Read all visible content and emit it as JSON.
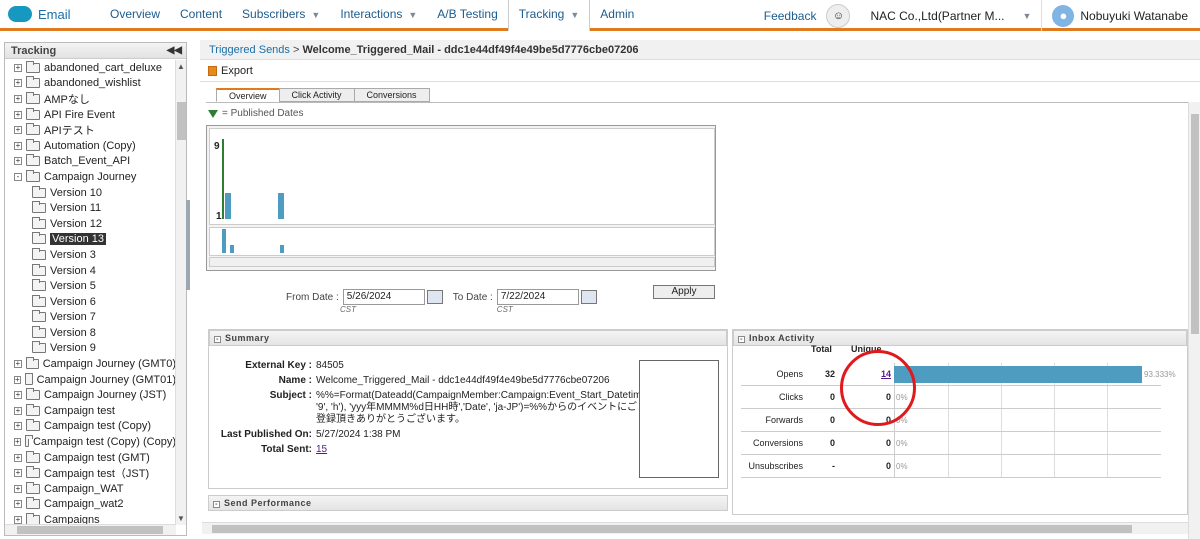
{
  "app": {
    "logo_text": "Email"
  },
  "nav": {
    "items": [
      {
        "label": "Overview",
        "caret": false
      },
      {
        "label": "Content",
        "caret": false
      },
      {
        "label": "Subscribers",
        "caret": true
      },
      {
        "label": "Interactions",
        "caret": true
      },
      {
        "label": "A/B Testing",
        "caret": false
      },
      {
        "label": "Tracking",
        "caret": true,
        "active": true
      },
      {
        "label": "Admin",
        "caret": false
      }
    ],
    "feedback": "Feedback",
    "org": "NAC Co.,Ltd(Partner M...",
    "user": "Nobuyuki Watanabe"
  },
  "sidebar": {
    "title": "Tracking",
    "items": [
      {
        "label": "abandoned_cart_deluxe",
        "indent": 0,
        "exp": "+"
      },
      {
        "label": "abandoned_wishlist",
        "indent": 0,
        "exp": "+"
      },
      {
        "label": "AMPなし",
        "indent": 0,
        "exp": "+"
      },
      {
        "label": "API Fire Event",
        "indent": 0,
        "exp": "+"
      },
      {
        "label": "APIテスト",
        "indent": 0,
        "exp": "+"
      },
      {
        "label": "Automation (Copy)",
        "indent": 0,
        "exp": "+"
      },
      {
        "label": "Batch_Event_API",
        "indent": 0,
        "exp": "+"
      },
      {
        "label": "Campaign Journey",
        "indent": 0,
        "exp": "-"
      },
      {
        "label": "Version 10",
        "indent": 1,
        "exp": ""
      },
      {
        "label": "Version 11",
        "indent": 1,
        "exp": ""
      },
      {
        "label": "Version 12",
        "indent": 1,
        "exp": ""
      },
      {
        "label": "Version 13",
        "indent": 1,
        "exp": "",
        "selected": true
      },
      {
        "label": "Version 3",
        "indent": 1,
        "exp": ""
      },
      {
        "label": "Version 4",
        "indent": 1,
        "exp": ""
      },
      {
        "label": "Version 5",
        "indent": 1,
        "exp": ""
      },
      {
        "label": "Version 6",
        "indent": 1,
        "exp": ""
      },
      {
        "label": "Version 7",
        "indent": 1,
        "exp": ""
      },
      {
        "label": "Version 8",
        "indent": 1,
        "exp": ""
      },
      {
        "label": "Version 9",
        "indent": 1,
        "exp": ""
      },
      {
        "label": "Campaign Journey (GMT0)",
        "indent": 0,
        "exp": "+"
      },
      {
        "label": "Campaign Journey (GMT01)",
        "indent": 0,
        "exp": "+"
      },
      {
        "label": "Campaign Journey (JST)",
        "indent": 0,
        "exp": "+"
      },
      {
        "label": "Campaign test",
        "indent": 0,
        "exp": "+"
      },
      {
        "label": "Campaign test (Copy)",
        "indent": 0,
        "exp": "+"
      },
      {
        "label": "Campaign test (Copy) (Copy)",
        "indent": 0,
        "exp": "+"
      },
      {
        "label": "Campaign test (GMT)",
        "indent": 0,
        "exp": "+"
      },
      {
        "label": "Campaign test（JST)",
        "indent": 0,
        "exp": "+"
      },
      {
        "label": "Campaign_WAT",
        "indent": 0,
        "exp": "+"
      },
      {
        "label": "Campaign_wat2",
        "indent": 0,
        "exp": "+"
      },
      {
        "label": "Campaigns",
        "indent": 0,
        "exp": "+"
      }
    ]
  },
  "breadcrumb": {
    "link": "Triggered Sends",
    "sep": " > ",
    "current": "Welcome_Triggered_Mail - ddc1e44df49f4e49be5d7776cbe07206"
  },
  "toolbar": {
    "export": "Export"
  },
  "tabs": [
    "Overview",
    "Click Activity",
    "Conversions"
  ],
  "legend": {
    "published": "= Published Dates"
  },
  "chart": {
    "y_top": "9",
    "y_bottom": "1"
  },
  "chart_data": {
    "type": "bar",
    "title": "",
    "ylim": [
      1,
      9
    ],
    "series": [
      {
        "values": [
          1,
          9,
          2,
          2
        ]
      }
    ]
  },
  "dates": {
    "from_label": "From Date :",
    "from_value": "5/26/2024",
    "to_label": "To Date :",
    "to_value": "7/22/2024",
    "tz": "CST",
    "apply": "Apply"
  },
  "summary": {
    "title": "Summary",
    "rows": [
      {
        "key": "External Key :",
        "value": "84505"
      },
      {
        "key": "Name :",
        "value": "Welcome_Triggered_Mail - ddc1e44df49f4e49be5d7776cbe07206"
      },
      {
        "key": "Subject :",
        "value": "%%=Format(Dateadd(CampaignMember:Campaign:Event_Start_Datetime__c, '9', 'h'), 'yyy年MMMM%d日HH時','Date', 'ja-JP')=%%からのイベントにご登録頂きありがとうございます。"
      },
      {
        "key": "Last Published On:",
        "value": "5/27/2024 1:38 PM"
      },
      {
        "key": "Total Sent:",
        "value": "15",
        "link": true
      }
    ]
  },
  "send_performance": {
    "title": "Send Performance"
  },
  "inbox": {
    "title": "Inbox Activity",
    "col_total": "Total",
    "col_unique": "Unique",
    "rows": [
      {
        "label": "Opens",
        "total": "32",
        "unique": "14",
        "pct": "93.333%",
        "fraction": 0.93333,
        "link": true
      },
      {
        "label": "Clicks",
        "total": "0",
        "unique": "0",
        "pct": "0%",
        "fraction": 0
      },
      {
        "label": "Forwards",
        "total": "0",
        "unique": "0",
        "pct": "0%",
        "fraction": 0
      },
      {
        "label": "Conversions",
        "total": "0",
        "unique": "0",
        "pct": "0%",
        "fraction": 0
      },
      {
        "label": "Unsubscribes",
        "total": "-",
        "unique": "0",
        "pct": "0%",
        "fraction": 0
      }
    ]
  }
}
